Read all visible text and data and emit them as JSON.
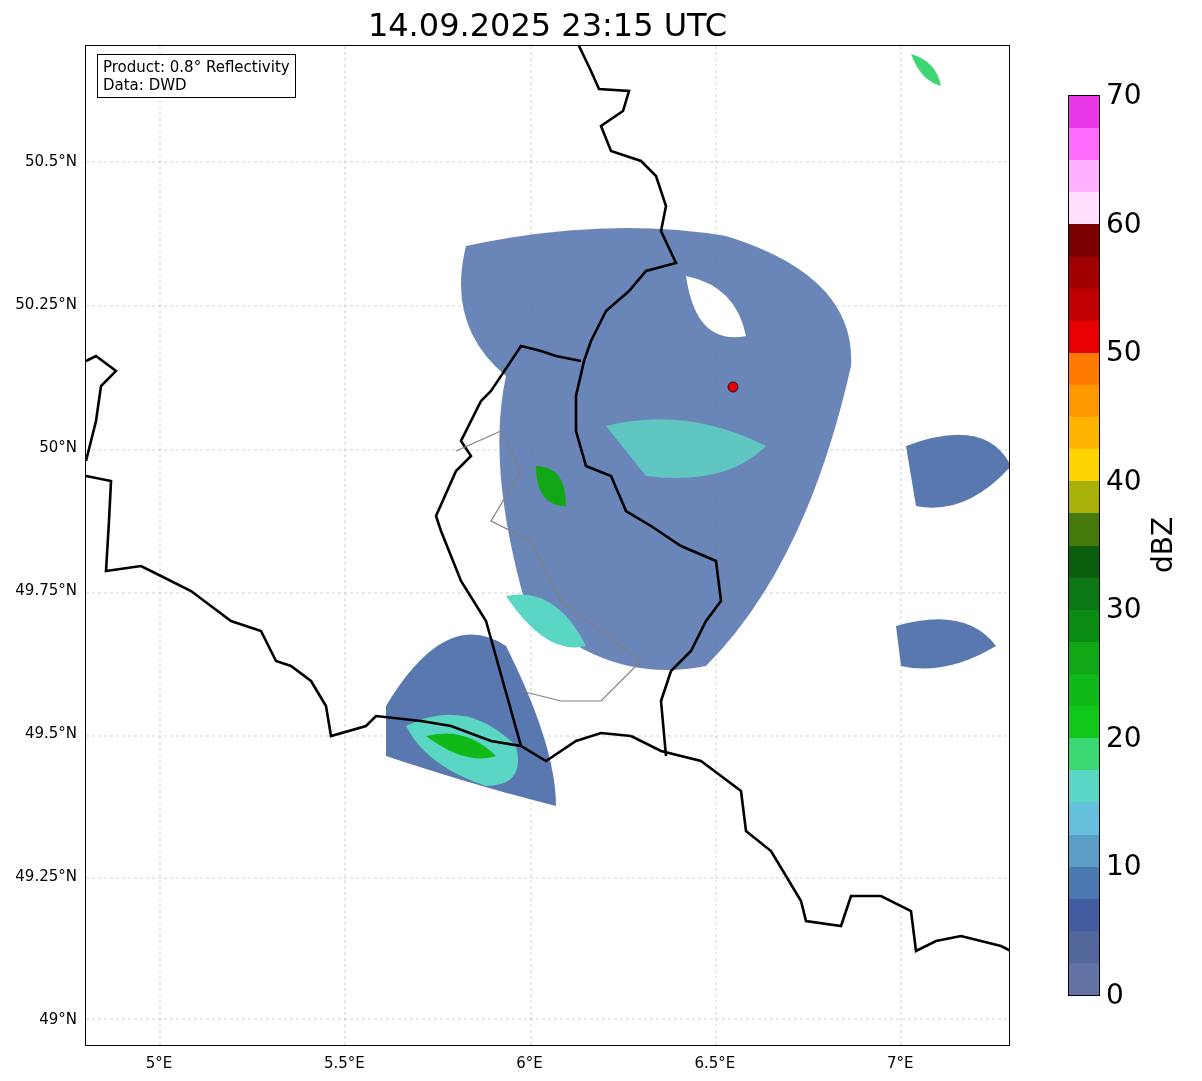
{
  "title": "14.09.2025 23:15 UTC",
  "info_box": {
    "lines": [
      "Product: 0.8° Reflectivity",
      "Data: DWD"
    ]
  },
  "y_ticks": [
    "50.5°N",
    "50.25°N",
    "50°N",
    "49.75°N",
    "49.5°N",
    "49.25°N",
    "49°N"
  ],
  "x_ticks": [
    "5°E",
    "5.5°E",
    "6°E",
    "6.5°E",
    "7°E"
  ],
  "colorbar": {
    "label": "dBZ",
    "ticks": [
      "70",
      "60",
      "50",
      "40",
      "30",
      "20",
      "10",
      "0"
    ],
    "segments": [
      {
        "color": "#e838e8"
      },
      {
        "color": "#ff6cff"
      },
      {
        "color": "#ffb0ff"
      },
      {
        "color": "#ffe0ff"
      },
      {
        "color": "#7a0000"
      },
      {
        "color": "#a00000"
      },
      {
        "color": "#c00000"
      },
      {
        "color": "#e80000"
      },
      {
        "color": "#ff7a00"
      },
      {
        "color": "#ff9a00"
      },
      {
        "color": "#ffb400"
      },
      {
        "color": "#ffd400"
      },
      {
        "color": "#aab00a"
      },
      {
        "color": "#467a0a"
      },
      {
        "color": "#0a5e0e"
      },
      {
        "color": "#0a7814"
      },
      {
        "color": "#0a8c12"
      },
      {
        "color": "#10a614"
      },
      {
        "color": "#10b818"
      },
      {
        "color": "#10c81a"
      },
      {
        "color": "#3cd672"
      },
      {
        "color": "#5cd6c4"
      },
      {
        "color": "#64c0dc"
      },
      {
        "color": "#5a9ec6"
      },
      {
        "color": "#4a78b0"
      },
      {
        "color": "#425ba1"
      },
      {
        "color": "#52679c"
      },
      {
        "color": "#6373a6"
      }
    ]
  }
}
